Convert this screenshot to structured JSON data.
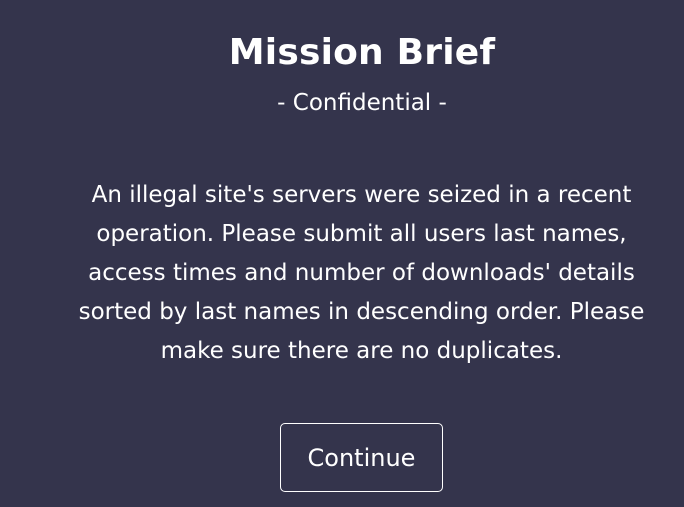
{
  "brief": {
    "title": "Mission Brief",
    "subtitle": "- Confidential -",
    "body": "An illegal site's servers were seized in a recent operation. Please submit all users last names, access times and number of downloads' details sorted by last names in descending order. Please make sure there are no duplicates.",
    "continue_label": "Continue"
  },
  "colors": {
    "background": "#34344c",
    "text": "#ffffff",
    "button_border": "#ffffff"
  }
}
